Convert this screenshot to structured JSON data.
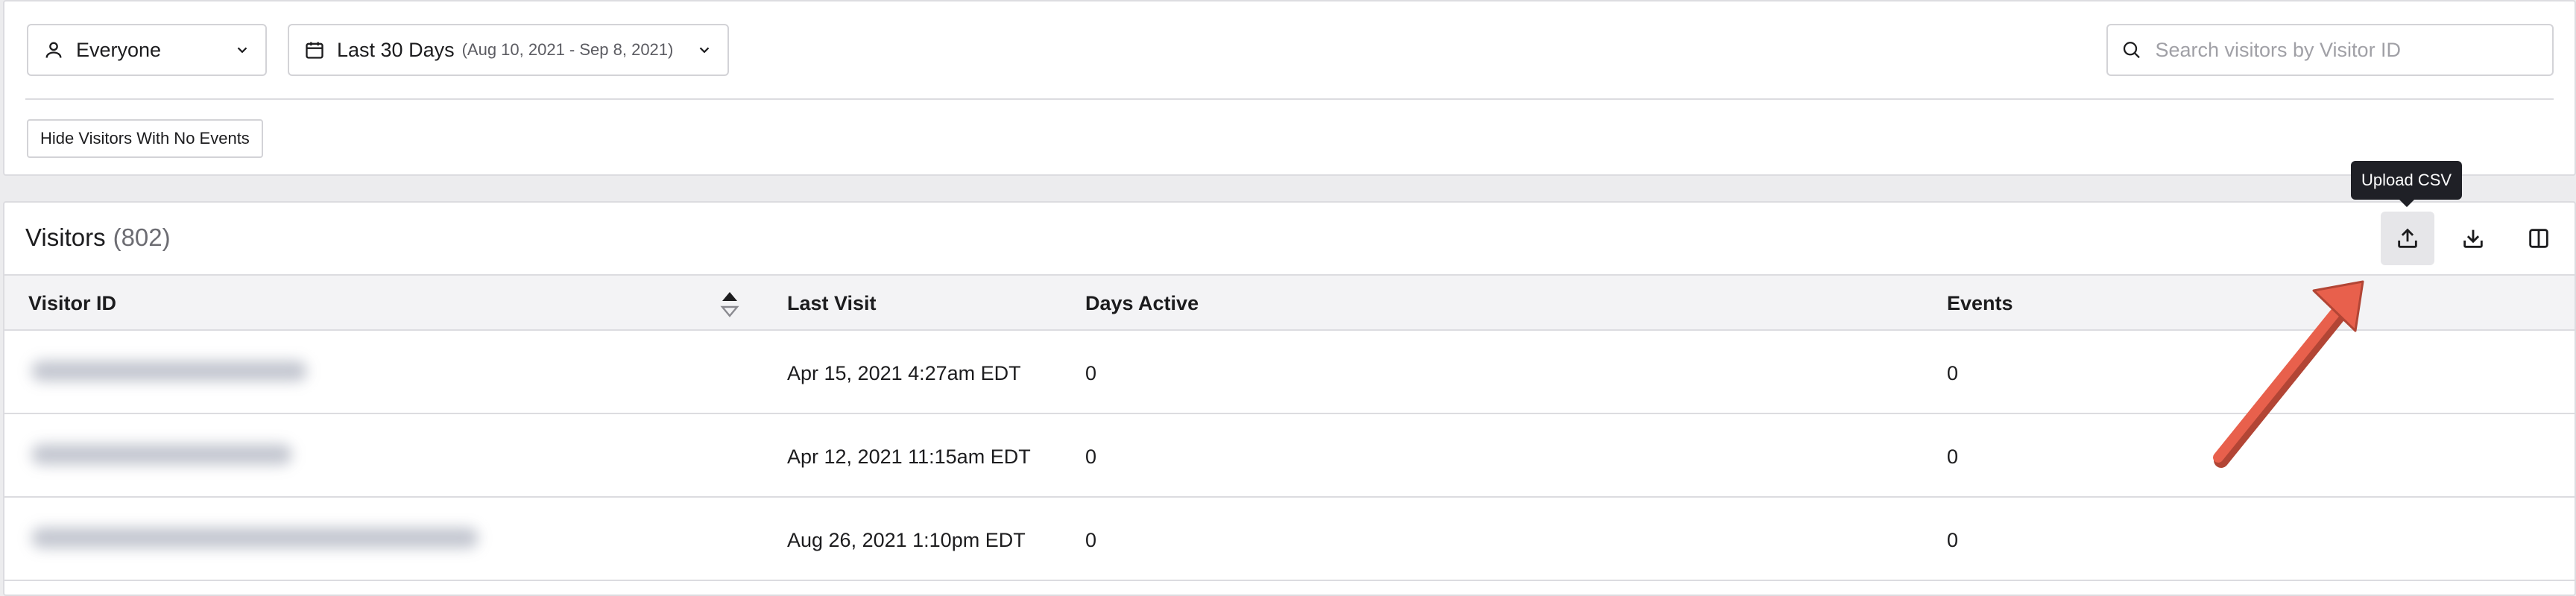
{
  "filters": {
    "audience": {
      "label": "Everyone",
      "icon": "user-icon"
    },
    "date_range": {
      "label": "Last 30 Days",
      "sub": "(Aug 10, 2021 - Sep 8, 2021)",
      "icon": "calendar-icon"
    },
    "search": {
      "placeholder": "Search visitors by Visitor ID",
      "value": ""
    },
    "hide_no_events_label": "Hide Visitors With No Events"
  },
  "visitors": {
    "title": "Visitors",
    "count": "(802)",
    "toolbar": {
      "upload_icon": "upload-icon",
      "download_icon": "download-icon",
      "columns_icon": "columns-icon",
      "tooltip": "Upload CSV"
    },
    "columns": [
      "Visitor ID",
      "Last Visit",
      "Days Active",
      "Events"
    ],
    "rows": [
      {
        "visitor_id": "",
        "last_visit": "Apr 15, 2021 4:27am EDT",
        "days_active": "0",
        "events": "0"
      },
      {
        "visitor_id": "",
        "last_visit": "Apr 12, 2021 11:15am EDT",
        "days_active": "0",
        "events": "0"
      },
      {
        "visitor_id": "",
        "last_visit": "Aug 26, 2021 1:10pm EDT",
        "days_active": "0",
        "events": "0"
      }
    ]
  },
  "colors": {
    "annotation_arrow": "#e8604c",
    "tooltip_bg": "#1f2026",
    "header_bg": "#f3f3f5"
  }
}
